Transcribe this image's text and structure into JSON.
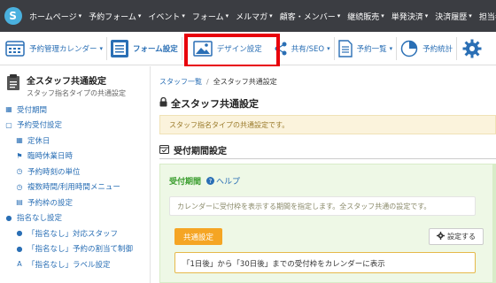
{
  "topnav": {
    "logo_letter": "S",
    "items": [
      {
        "label": "ホームページ",
        "caret": true
      },
      {
        "label": "予約フォーム",
        "caret": true
      },
      {
        "label": "イベント",
        "caret": true
      },
      {
        "label": "フォーム",
        "caret": true
      },
      {
        "label": "メルマガ",
        "caret": true
      },
      {
        "label": "顧客・メンバー",
        "caret": true
      },
      {
        "label": "継続販売",
        "caret": true
      },
      {
        "label": "単発決済",
        "caret": true
      },
      {
        "label": "決済履歴",
        "caret": true
      },
      {
        "label": "担当者",
        "caret": true
      }
    ]
  },
  "toolbar": {
    "calendar_label": "予約管理カレンダー",
    "form_settings_label": "フォーム設定",
    "design_label": "デザイン設定",
    "share_label": "共有/SEO",
    "list_label": "予約一覧",
    "stats_label": "予約統計",
    "accent": "#2a6fb5",
    "highlight_color": "#e8000b"
  },
  "sidebar": {
    "title": "全スタッフ共通設定",
    "subtitle": "スタッフ指名タイプの共通設定",
    "items": [
      {
        "label": "受付期間",
        "icon": "calendar-icon",
        "level": 1
      },
      {
        "label": "予約受付設定",
        "icon": "square-icon",
        "level": 1
      },
      {
        "label": "定休日",
        "icon": "calendar-grid-icon",
        "level": 2
      },
      {
        "label": "臨時休業日時",
        "icon": "flag-icon",
        "level": 2
      },
      {
        "label": "予約時刻の単位",
        "icon": "clock-icon",
        "level": 2
      },
      {
        "label": "複数時間/利用時間メニュー",
        "icon": "clock-icon",
        "level": 2
      },
      {
        "label": "予約枠の設定",
        "icon": "table-icon",
        "level": 2
      },
      {
        "label": "指名なし設定",
        "icon": "user-icon",
        "level": 1
      },
      {
        "label": "「指名なし」対応スタッフ",
        "icon": "users-icon",
        "level": 2
      },
      {
        "label": "「指名なし」予約の割当て制御",
        "icon": "users-icon",
        "level": 2
      },
      {
        "label": "「指名なし」ラベル設定",
        "icon": "font-icon",
        "level": 2
      }
    ]
  },
  "main": {
    "breadcrumb": {
      "link": "スタッフ一覧",
      "separator": "/",
      "current": "全スタッフ共通設定"
    },
    "title": "全スタッフ共通設定",
    "info_text": "スタッフ指名タイプの共通設定です。",
    "section_title": "受付期間設定",
    "panel": {
      "title": "受付期間",
      "help_label": "ヘルプ",
      "note": "カレンダーに受付枠を表示する期間を指定します。全スタッフ共通の設定です。",
      "badge": "共通設定",
      "set_button": "設定する",
      "description": "「1日後」から「30日後」までの受付枠をカレンダーに表示"
    }
  }
}
